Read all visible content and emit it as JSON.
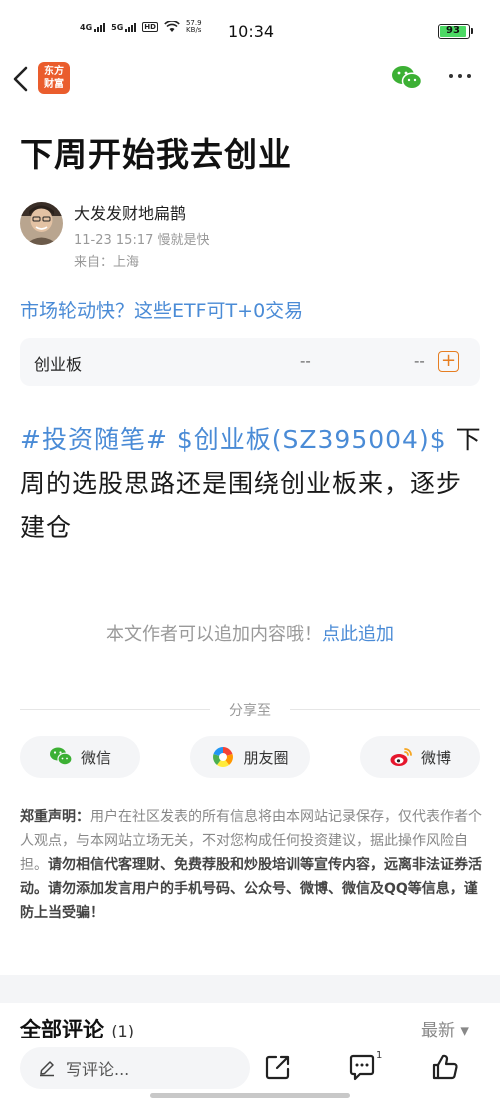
{
  "status_bar": {
    "network1": "4G",
    "network2": "5G",
    "hd_label": "HD",
    "speed_value": "57.9",
    "speed_unit": "KB/s",
    "time": "10:34",
    "battery": "93"
  },
  "nav": {
    "logo_line1": "东方",
    "logo_line2": "财富"
  },
  "post": {
    "title": "下周开始我去创业",
    "author_name": "大发发财地扁鹊",
    "time_line": "11-23 15:17 慢就是快",
    "location": "来自：上海",
    "promo_link": "市场轮动快？这些ETF可T+0交易",
    "quote": {
      "name": "创业板",
      "value1": "--",
      "value2": "--",
      "add_label": "+"
    },
    "body_tag1": "#投资随笔#",
    "body_tag2": "$创业板(SZ395004)$",
    "body_text": " 下周的选股思路还是围绕创业板来，逐步建仓"
  },
  "append": {
    "text": "本文作者可以追加内容哦！",
    "link": "点此追加"
  },
  "share": {
    "label": "分享至",
    "wechat": "微信",
    "moments": "朋友圈",
    "weibo": "微博"
  },
  "disclaimer": {
    "heading": "郑重声明：",
    "normal_text": "用户在社区发表的所有信息将由本网站记录保存，仅代表作者个人观点，与本网站立场无关，不对您构成任何投资建议，据此操作风险自担。",
    "bold_text": "请勿相信代客理财、免费荐股和炒股培训等宣传内容，远离非法证券活动。请勿添加发言用户的手机号码、公众号、微博、微信及QQ等信息，谨防上当受骗！"
  },
  "comments": {
    "title": "全部评论",
    "count": "(1)",
    "sort": "最新 ▾"
  },
  "bottom_bar": {
    "input_placeholder": "写评论...",
    "comment_badge": "1"
  },
  "colors": {
    "accent_blue": "#4a8bd6",
    "brand_orange": "#ea5d2d",
    "battery_green": "#4cd964"
  }
}
